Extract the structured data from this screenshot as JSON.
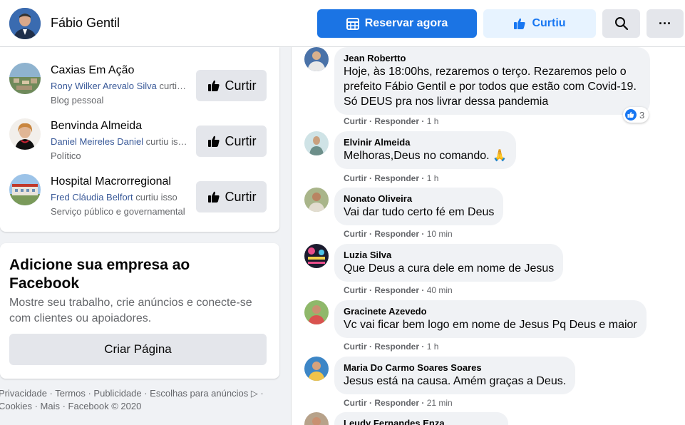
{
  "header": {
    "page_name": "Fábio Gentil",
    "reserve_label": "Reservar agora",
    "liked_label": "Curtiu",
    "more_label": "···",
    "brand_color": "#1b74e4"
  },
  "suggestions": [
    {
      "title": "Caxias Em Ação",
      "liked_by": "Rony Wilker Arevalo Silva",
      "suffix": " curtiu isso",
      "category": "Blog pessoal",
      "button": "Curtir"
    },
    {
      "title": "Benvinda Almeida",
      "liked_by": "Daniel Meireles Daniel",
      "suffix": " curtiu isso",
      "category": "Político",
      "button": "Curtir"
    },
    {
      "title": "Hospital Macrorregional",
      "liked_by": "Fred Cláudia Belfort",
      "suffix": " curtiu isso",
      "category": "Serviço público e governamental",
      "button": "Curtir"
    }
  ],
  "business": {
    "title": "Adicione sua empresa ao Facebook",
    "description": "Mostre seu trabalho, crie anúncios e conecte-se com clientes ou apoiadores.",
    "button": "Criar Página"
  },
  "footer": {
    "line1": "Privacidade · Termos · Publicidade · Escolhas para anúncios ▷ ·",
    "line2": "Cookies · Mais · Facebook © 2020"
  },
  "comments": [
    {
      "author": "Jean Robertto",
      "text": "Hoje, às 18:00hs, rezaremos o terço. Rezaremos pelo o prefeito Fábio Gentil e por todos que estão com Covid-19. Só DEUS pra nos livrar dessa pandemia",
      "like": "Curtir",
      "reply": "Responder",
      "time": "1 h",
      "reactions": "3"
    },
    {
      "author": "Elvinir Almeida",
      "text": "Melhoras,Deus no comando. 🙏",
      "like": "Curtir",
      "reply": "Responder",
      "time": "1 h"
    },
    {
      "author": "Nonato Oliveira",
      "text": "Vai dar tudo certo fé em Deus",
      "like": "Curtir",
      "reply": "Responder",
      "time": "10 min"
    },
    {
      "author": "Luzia Silva",
      "text": "Que Deus a cura dele em nome de Jesus",
      "like": "Curtir",
      "reply": "Responder",
      "time": "40 min"
    },
    {
      "author": "Gracinete Azevedo",
      "text": "Vc vai ficar bem logo em nome de Jesus Pq Deus e maior",
      "like": "Curtir",
      "reply": "Responder",
      "time": "1 h"
    },
    {
      "author": "Maria Do Carmo Soares Soares",
      "text": "Jesus está na causa. Amém graças a Deus.",
      "like": "Curtir",
      "reply": "Responder",
      "time": "21 min"
    },
    {
      "author": "Leudy Fernandes Enza"
    }
  ]
}
